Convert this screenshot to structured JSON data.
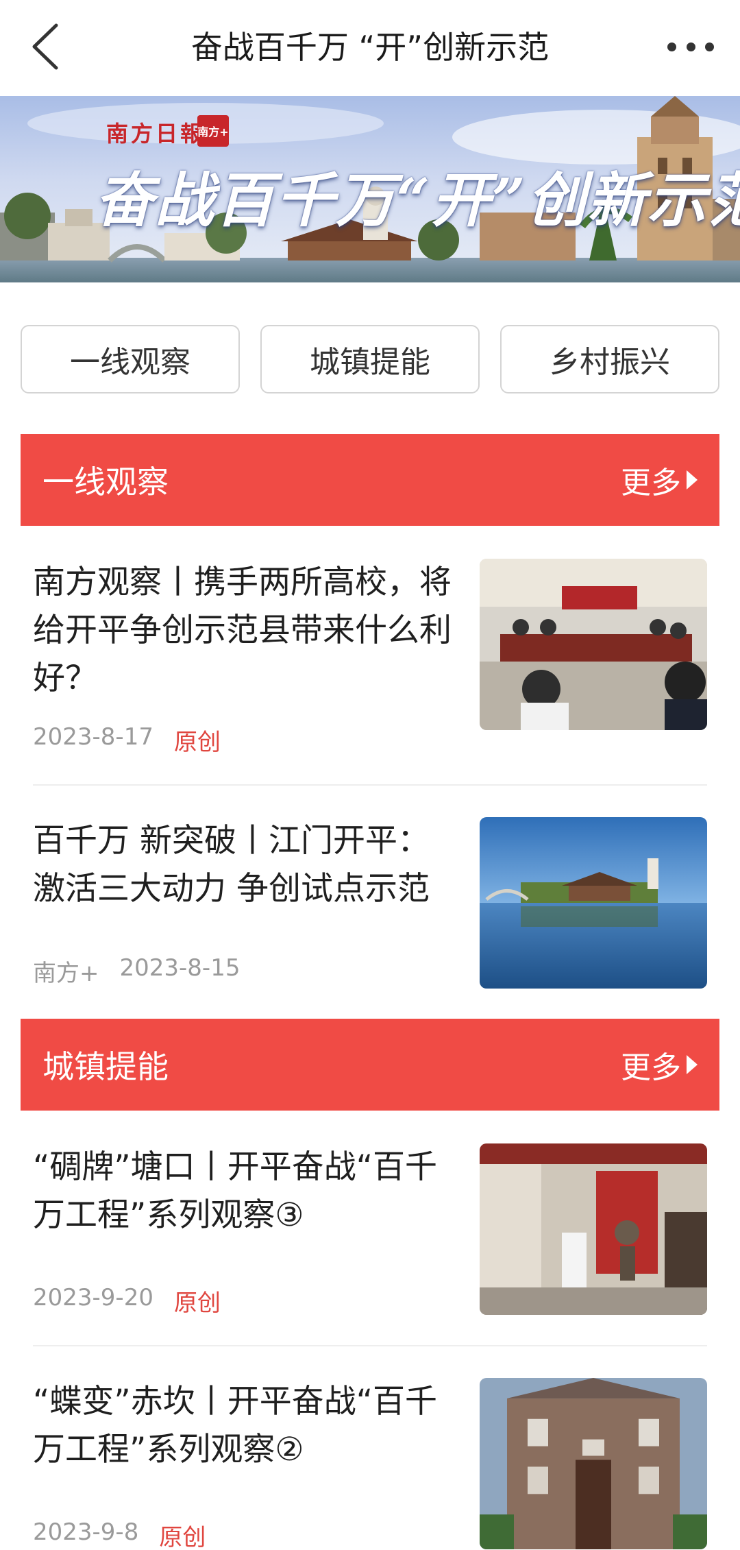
{
  "header": {
    "title": "奋战百千万 “开”创新示范",
    "back_icon": "chevron-left-icon",
    "more_icon": "more-dots-icon"
  },
  "banner": {
    "brand": "南方日報",
    "logo_text": "南方+",
    "title": "奋战百千万“开”创新示范"
  },
  "tabs": [
    {
      "label": "一线观察"
    },
    {
      "label": "城镇提能"
    },
    {
      "label": "乡村振兴"
    }
  ],
  "sections": [
    {
      "title": "一线观察",
      "more_label": "更多",
      "articles": [
        {
          "headline": "南方观察丨携手两所高校，将给开平争创示范县带来什么利好？",
          "source": "",
          "date": "2023-8-17",
          "tag": "原创"
        },
        {
          "headline": "百千万 新突破丨江门开平：激活三大动力 争创试点示范",
          "source": "南方+",
          "date": "2023-8-15",
          "tag": ""
        }
      ]
    },
    {
      "title": "城镇提能",
      "more_label": "更多",
      "articles": [
        {
          "headline": "“碉牌”塘口丨开平奋战“百千万工程”系列观察③",
          "source": "",
          "date": "2023-9-20",
          "tag": "原创"
        },
        {
          "headline": "“蝶变”赤坎丨开平奋战“百千万工程”系列观察②",
          "source": "",
          "date": "2023-9-8",
          "tag": "原创"
        }
      ]
    }
  ],
  "colors": {
    "accent": "#f04b45",
    "tag": "#e0463f",
    "meta": "#9a9a9a"
  }
}
